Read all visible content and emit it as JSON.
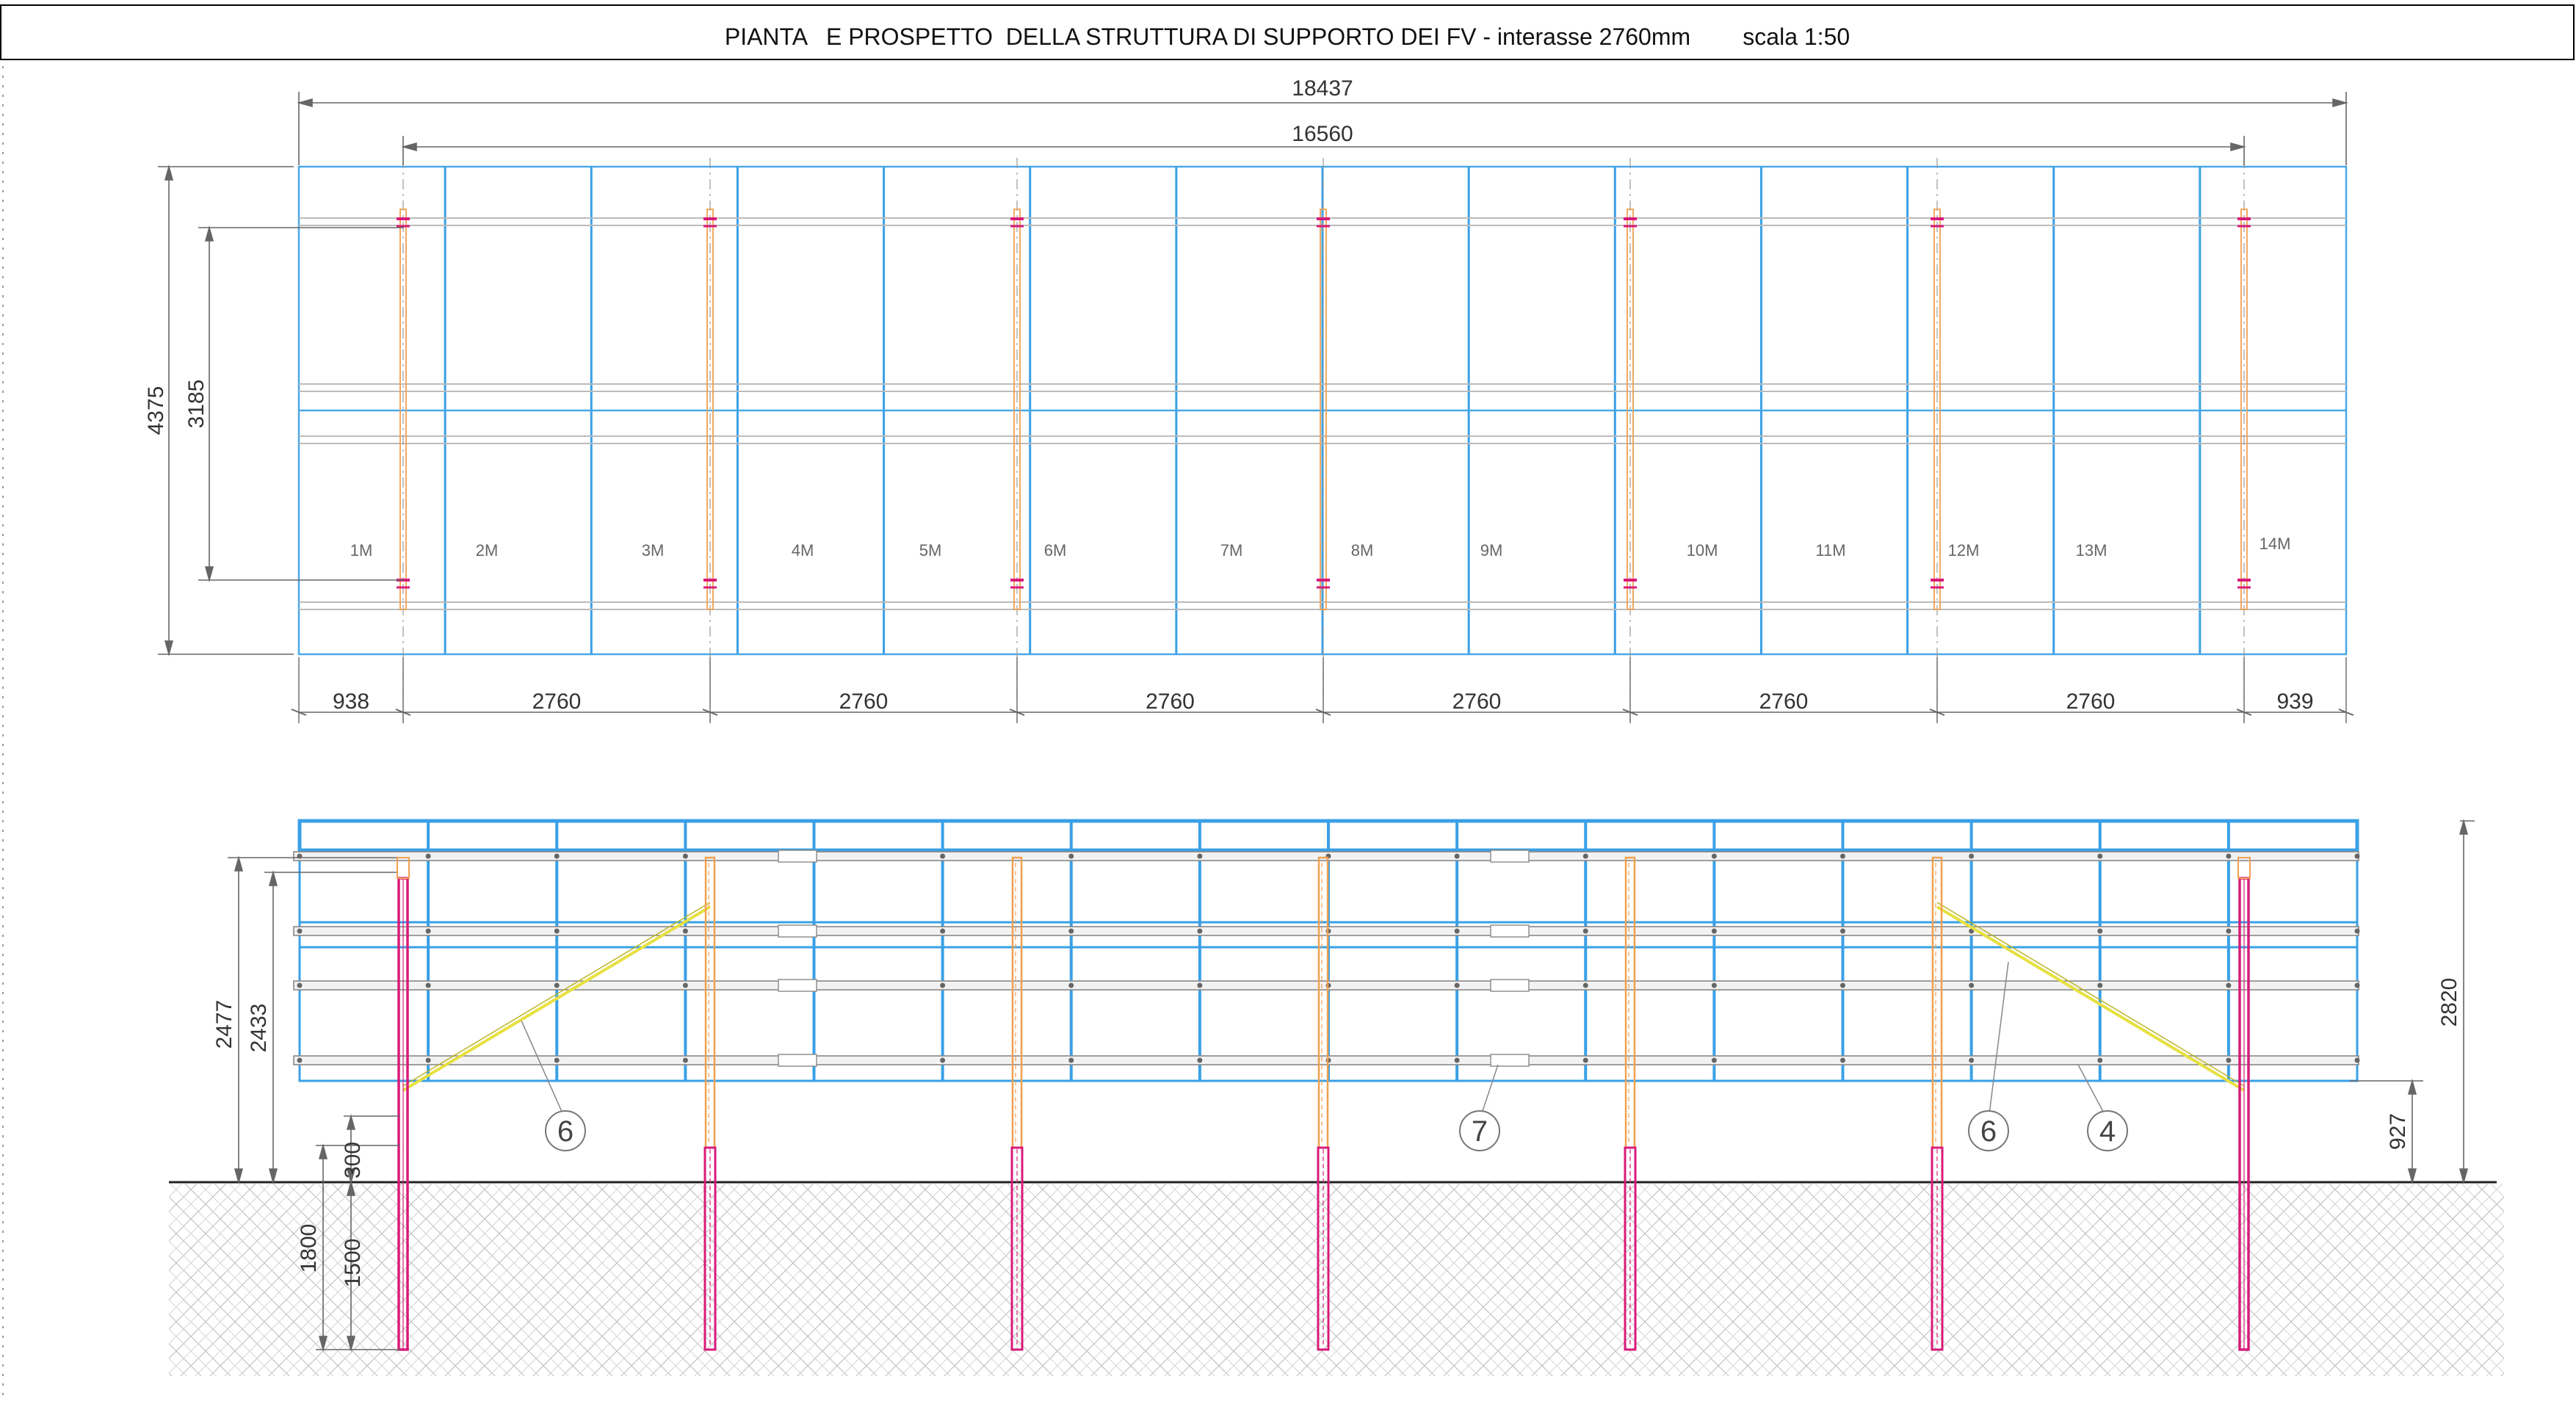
{
  "title": {
    "text": "PIANTA   E PROSPETTO  DELLA STRUTTURA DI SUPPORTO DEI FV - interasse 2760mm        scala 1:50"
  },
  "plan": {
    "overall_length": "18437",
    "axis_length": "16560",
    "overall_width": "4375",
    "axis_width": "3185",
    "modules": [
      "1M",
      "2M",
      "3M",
      "4M",
      "5M",
      "6M",
      "7M",
      "8M",
      "9M",
      "10M",
      "11M",
      "12M",
      "13M",
      "14M"
    ],
    "bottom_dims": [
      "938",
      "2760",
      "2760",
      "2760",
      "2760",
      "2760",
      "2760",
      "939"
    ]
  },
  "elevation": {
    "height_total": "2820",
    "height_front": "2477",
    "height_post": "2433",
    "clearance": "927",
    "embed_total": "1800",
    "embed_upper": "300",
    "embed_lower": "1500",
    "callouts": [
      "6",
      "7",
      "6",
      "4"
    ]
  },
  "colors": {
    "module_blue": "#3aa0e6",
    "post_orange": "#f0a050",
    "pile_magenta": "#d81b7a",
    "brace_yellow": "#e8e040",
    "dimension": "#555555"
  }
}
